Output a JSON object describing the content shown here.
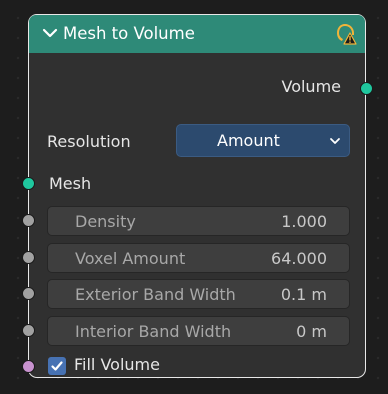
{
  "node": {
    "title": "Mesh to Volume",
    "outputs": [
      {
        "label": "Volume",
        "socket_color": "#1fc79e"
      }
    ],
    "resolution": {
      "label": "Resolution",
      "selected": "Amount"
    },
    "inputs": {
      "mesh_label": "Mesh",
      "fields": [
        {
          "label": "Density",
          "value": "1.000"
        },
        {
          "label": "Voxel Amount",
          "value": "64.000"
        },
        {
          "label": "Exterior Band Width",
          "value": "0.1 m"
        },
        {
          "label": "Interior Band Width",
          "value": "0 m"
        }
      ],
      "fill_volume": {
        "label": "Fill Volume",
        "checked": true
      }
    }
  },
  "colors": {
    "header": "#2e8a78",
    "geometry_socket": "#1fc79e",
    "float_socket": "#a1a1a1",
    "boolean_socket": "#c892cf",
    "selector": "#2c4a6e",
    "checkbox": "#4772b3"
  },
  "icons": {
    "collapse": "chevron-down-icon",
    "warning": "warning-icon"
  }
}
